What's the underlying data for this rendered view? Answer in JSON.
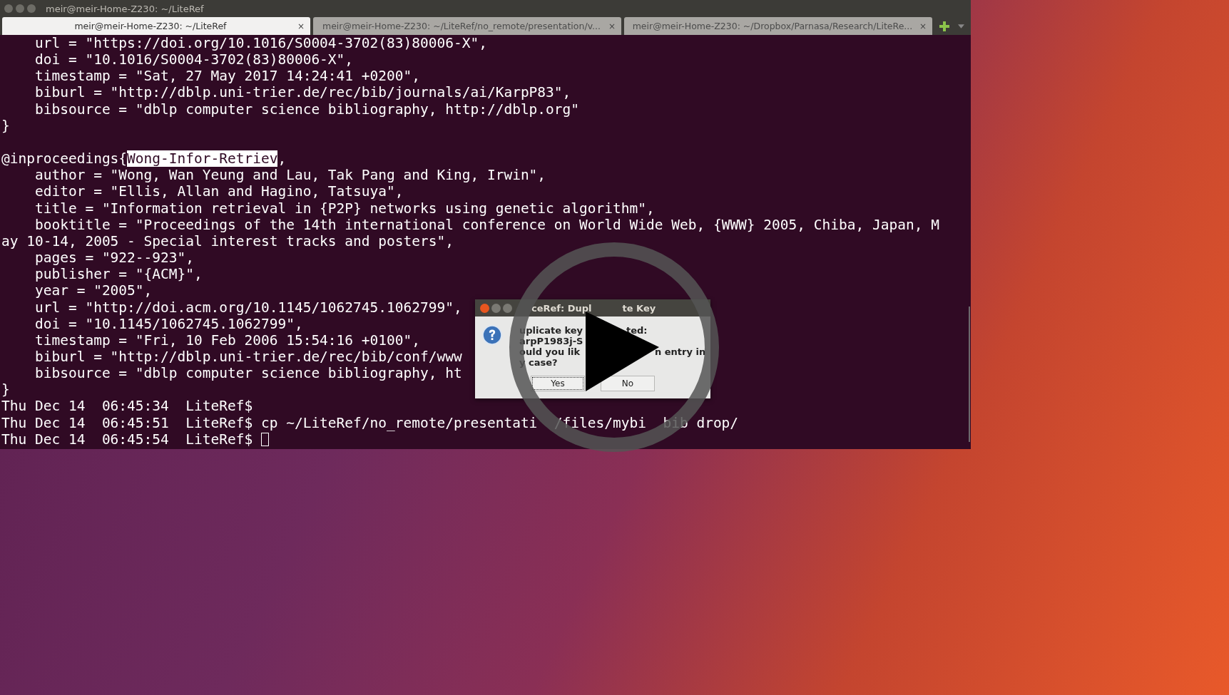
{
  "window": {
    "title": "meir@meir-Home-Z230: ~/LiteRef"
  },
  "tabs": [
    {
      "label": "meir@meir-Home-Z230: ~/LiteRef",
      "selected": true,
      "close": "×"
    },
    {
      "label": "meir@meir-Home-Z230: ~/LiteRef/no_remote/presentation/v...",
      "selected": false,
      "close": "×"
    },
    {
      "label": "meir@meir-Home-Z230: ~/Dropbox/Parnasa/Research/LiteRe...",
      "selected": false,
      "close": "×"
    }
  ],
  "terminal": {
    "lines": [
      {
        "kind": "text",
        "text": "    url = \"https://doi.org/10.1016/S0004-3702(83)80006-X\","
      },
      {
        "kind": "text",
        "text": "    doi = \"10.1016/S0004-3702(83)80006-X\","
      },
      {
        "kind": "text",
        "text": "    timestamp = \"Sat, 27 May 2017 14:24:41 +0200\","
      },
      {
        "kind": "text",
        "text": "    biburl = \"http://dblp.uni-trier.de/rec/bib/journals/ai/KarpP83\","
      },
      {
        "kind": "text",
        "text": "    bibsource = \"dblp computer science bibliography, http://dblp.org\""
      },
      {
        "kind": "text",
        "text": "}"
      },
      {
        "kind": "blank"
      },
      {
        "kind": "parts",
        "parts": [
          {
            "text": "@inproceedings{",
            "selected": false
          },
          {
            "text": "Wong-Infor-Retriev",
            "selected": true
          },
          {
            "text": ",",
            "selected": false
          }
        ]
      },
      {
        "kind": "text",
        "text": "    author = \"Wong, Wan Yeung and Lau, Tak Pang and King, Irwin\","
      },
      {
        "kind": "text",
        "text": "    editor = \"Ellis, Allan and Hagino, Tatsuya\","
      },
      {
        "kind": "text",
        "text": "    title = \"Information retrieval in {P2P} networks using genetic algorithm\","
      },
      {
        "kind": "text",
        "text": "    booktitle = \"Proceedings of the 14th international conference on World Wide Web, {WWW} 2005, Chiba, Japan, M"
      },
      {
        "kind": "text",
        "text": "ay 10-14, 2005 - Special interest tracks and posters\","
      },
      {
        "kind": "text",
        "text": "    pages = \"922--923\","
      },
      {
        "kind": "text",
        "text": "    publisher = \"{ACM}\","
      },
      {
        "kind": "text",
        "text": "    year = \"2005\","
      },
      {
        "kind": "text",
        "text": "    url = \"http://doi.acm.org/10.1145/1062745.1062799\","
      },
      {
        "kind": "text",
        "text": "    doi = \"10.1145/1062745.1062799\","
      },
      {
        "kind": "text",
        "text": "    timestamp = \"Fri, 10 Feb 2006 15:54:16 +0100\","
      },
      {
        "kind": "text",
        "text": "    biburl = \"http://dblp.uni-trier.de/rec/bib/conf/www"
      },
      {
        "kind": "text",
        "text": "    bibsource = \"dblp computer science bibliography, ht"
      },
      {
        "kind": "text",
        "text": "}"
      },
      {
        "kind": "text",
        "text": "Thu Dec 14  06:45:34  LiteRef$"
      },
      {
        "kind": "fragments",
        "fragments": [
          "Thu Dec 14  06:45:51  LiteRef$ cp ~/LiteRef/no_remote/presentati",
          "/files/mybi",
          "bib drop/"
        ]
      },
      {
        "kind": "prompt",
        "text": "Thu Dec 14  06:45:54  LiteRef$ ",
        "cursor": true
      }
    ]
  },
  "dialog": {
    "title_parts": [
      "ceRef: Dupl",
      "te Key"
    ],
    "message": [
      {
        "left": "uplicate key",
        "right": "ted:"
      },
      {
        "left": "arpP1983j-S"
      },
      {
        "left": "ould you lik",
        "right": "n entry in"
      },
      {
        "left": "y case?"
      }
    ],
    "buttons": [
      {
        "label": "Yes",
        "focused": true
      },
      {
        "label": "No",
        "focused": false
      }
    ]
  }
}
